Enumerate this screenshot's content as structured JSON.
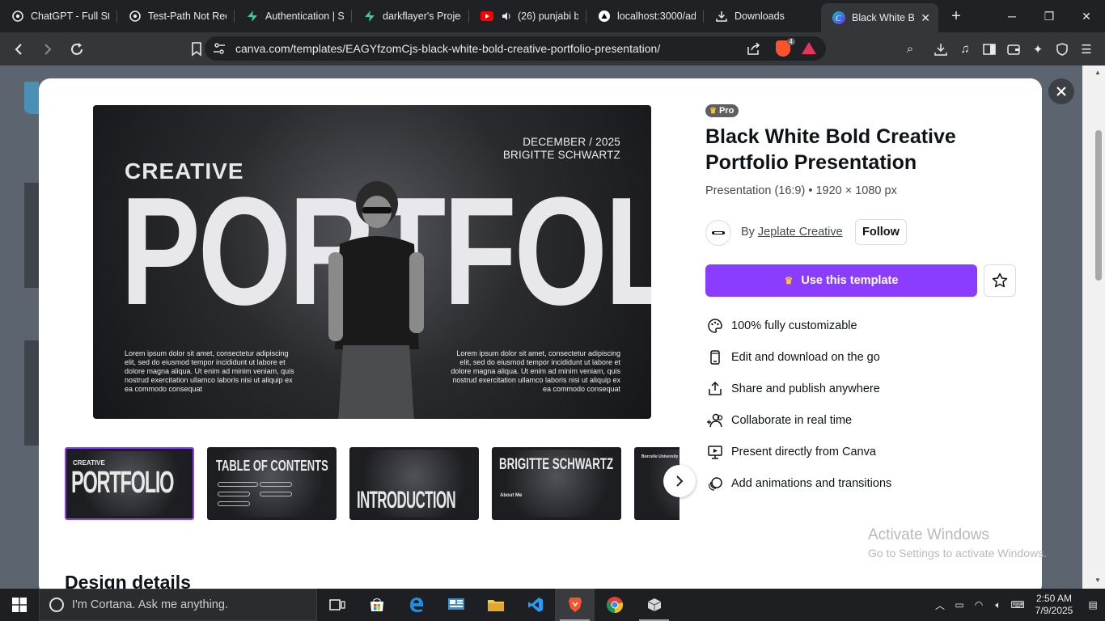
{
  "browser": {
    "tabs": [
      {
        "label": "ChatGPT - Full Sta",
        "icon": "chatgpt-icon"
      },
      {
        "label": "Test-Path Not Rec",
        "icon": "chatgpt-icon"
      },
      {
        "label": "Authentication | S",
        "icon": "supabase-icon"
      },
      {
        "label": "darkflayer's Projec",
        "icon": "supabase-icon"
      },
      {
        "label": "(26) punjabi b",
        "icon": "youtube-icon"
      },
      {
        "label": "localhost:3000/ad",
        "icon": "vercel-icon"
      },
      {
        "label": "Downloads",
        "icon": "download-icon"
      },
      {
        "label": "Black White B",
        "icon": "canva-icon",
        "active": true
      }
    ],
    "url": "canva.com/templates/EAGYfzomCjs-black-white-bold-creative-portfolio-presentation/",
    "brave_badge": "4"
  },
  "preview": {
    "date_line1": "DECEMBER / 2025",
    "date_line2": "BRIGITTE SCHWARTZ",
    "subtitle": "CREATIVE",
    "headline": "PORTFOLIO",
    "lorem_left": "Lorem ipsum dolor sit amet, consectetur adipiscing elit, sed do eiusmod tempor incididunt ut labore et dolore magna aliqua. Ut enim ad minim veniam, quis nostrud exercitation ullamco laboris nisi ut aliquip ex ea commodo consequat",
    "lorem_right": "Lorem ipsum dolor sit amet, consectetur adipiscing elit, sed do eiusmod tempor incididunt ut labore et dolore magna aliqua. Ut enim ad minim veniam, quis nostrud exercitation ullamco laboris nisi ut aliquip ex ea commodo consequat"
  },
  "thumbnails": [
    {
      "title": "PORTFOLIO",
      "small": "CREATIVE"
    },
    {
      "title": "TABLE OF CONTENTS",
      "small": ""
    },
    {
      "title": "INTRODUCTION",
      "small": ""
    },
    {
      "title": "BRIGITTE SCHWARTZ",
      "small": "About Me"
    },
    {
      "title": "",
      "small": "Borcelle University"
    }
  ],
  "details_heading": "Design details",
  "info": {
    "badge": "Pro",
    "title": "Black White Bold Creative Portfolio Presentation",
    "meta": "Presentation (16:9) • 1920 × 1080 px",
    "by": "By",
    "author": "Jeplate Creative",
    "follow": "Follow",
    "use_template": "Use this template",
    "features": [
      {
        "label": "100% fully customizable",
        "icon": "palette-icon"
      },
      {
        "label": "Edit and download on the go",
        "icon": "phone-icon"
      },
      {
        "label": "Share and publish anywhere",
        "icon": "share-icon"
      },
      {
        "label": "Collaborate in real time",
        "icon": "people-icon"
      },
      {
        "label": "Present directly from Canva",
        "icon": "present-icon"
      },
      {
        "label": "Add animations and transitions",
        "icon": "animation-icon"
      }
    ]
  },
  "watermark": {
    "line1": "Activate Windows",
    "line2": "Go to Settings to activate Windows."
  },
  "taskbar": {
    "search_placeholder": "I'm Cortana. Ask me anything.",
    "time": "2:50 AM",
    "date": "7/9/2025"
  },
  "colors": {
    "accent": "#8b3dff",
    "pro_badge": "#615e5e",
    "crown": "#ffc431"
  }
}
